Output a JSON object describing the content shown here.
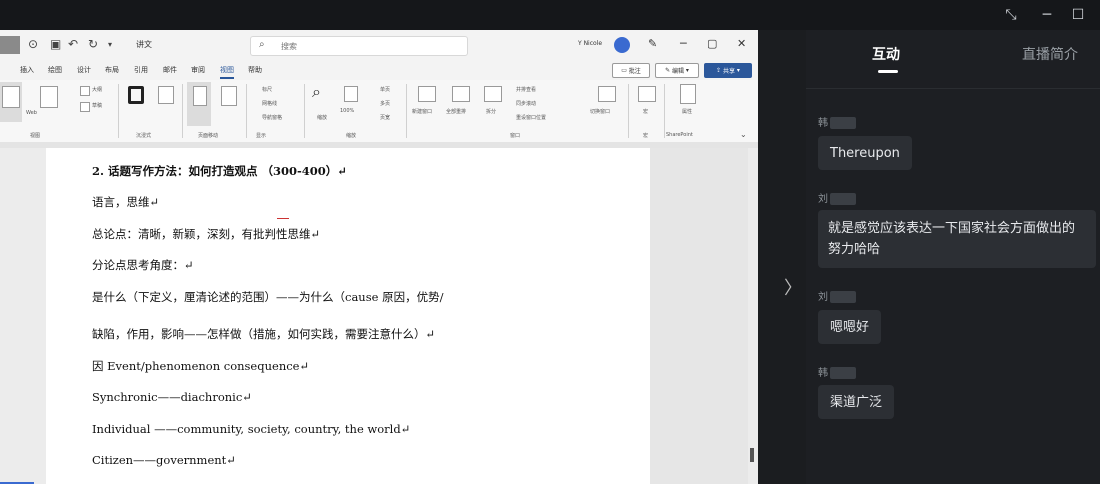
{
  "word": {
    "doc_name": "讲文",
    "search_placeholder": "搜索",
    "user_name": "Y Nicole",
    "tabs": [
      "插入",
      "绘图",
      "设计",
      "布局",
      "引用",
      "邮件",
      "审阅",
      "视图",
      "帮助"
    ],
    "active_tab_index": 7,
    "buttons": {
      "comments": "批注",
      "editing": "编辑",
      "share": "共享"
    },
    "ribbon": {
      "views": [
        "阅读",
        "Web",
        "大纲",
        "草稿"
      ],
      "page_movement": "页面移动",
      "groups": [
        "视图",
        "沉浸式",
        "页面移动",
        "显示",
        "缩放",
        "窗口",
        "宏",
        "SharePoint"
      ],
      "show": [
        "标尺",
        "网格线",
        "导航窗格"
      ],
      "zoom": [
        "缩放",
        "100%",
        "单页",
        "多页",
        "页宽"
      ],
      "window": [
        "新建窗口",
        "全部重排",
        "拆分",
        "并排查看",
        "同步滚动",
        "重设窗口位置",
        "切换窗口"
      ],
      "macros": "宏",
      "properties": "属性"
    },
    "document_lines": [
      "2. 话题写作方法：如何打造观点 （300-400）↵",
      "语言，思维↵",
      "总论点：清晰，新颖，深刻，有批判性思维↵",
      "分论点思考角度：↵",
      "是什么（下定义，厘清论述的范围）——为什么（cause 原因，优势/",
      "缺陷，作用，影响——怎样做（措施，如何实践，需要注意什么）↵",
      "因 Event/phenomenon   consequence↵",
      "Synchronic——diachronic↵",
      "Individual ——community, society, country, the world↵",
      "Citizen——government↵"
    ]
  },
  "panel": {
    "tabs": {
      "interaction": "互动",
      "intro": "直播简介"
    },
    "messages": [
      {
        "user": "韩",
        "text": "Thereupon"
      },
      {
        "user": "刘",
        "text": "就是感觉应该表达一下国家社会方面做出的努力哈哈"
      },
      {
        "user": "刘",
        "text": "嗯嗯好"
      },
      {
        "user": "韩",
        "text": "渠道广泛"
      }
    ]
  }
}
